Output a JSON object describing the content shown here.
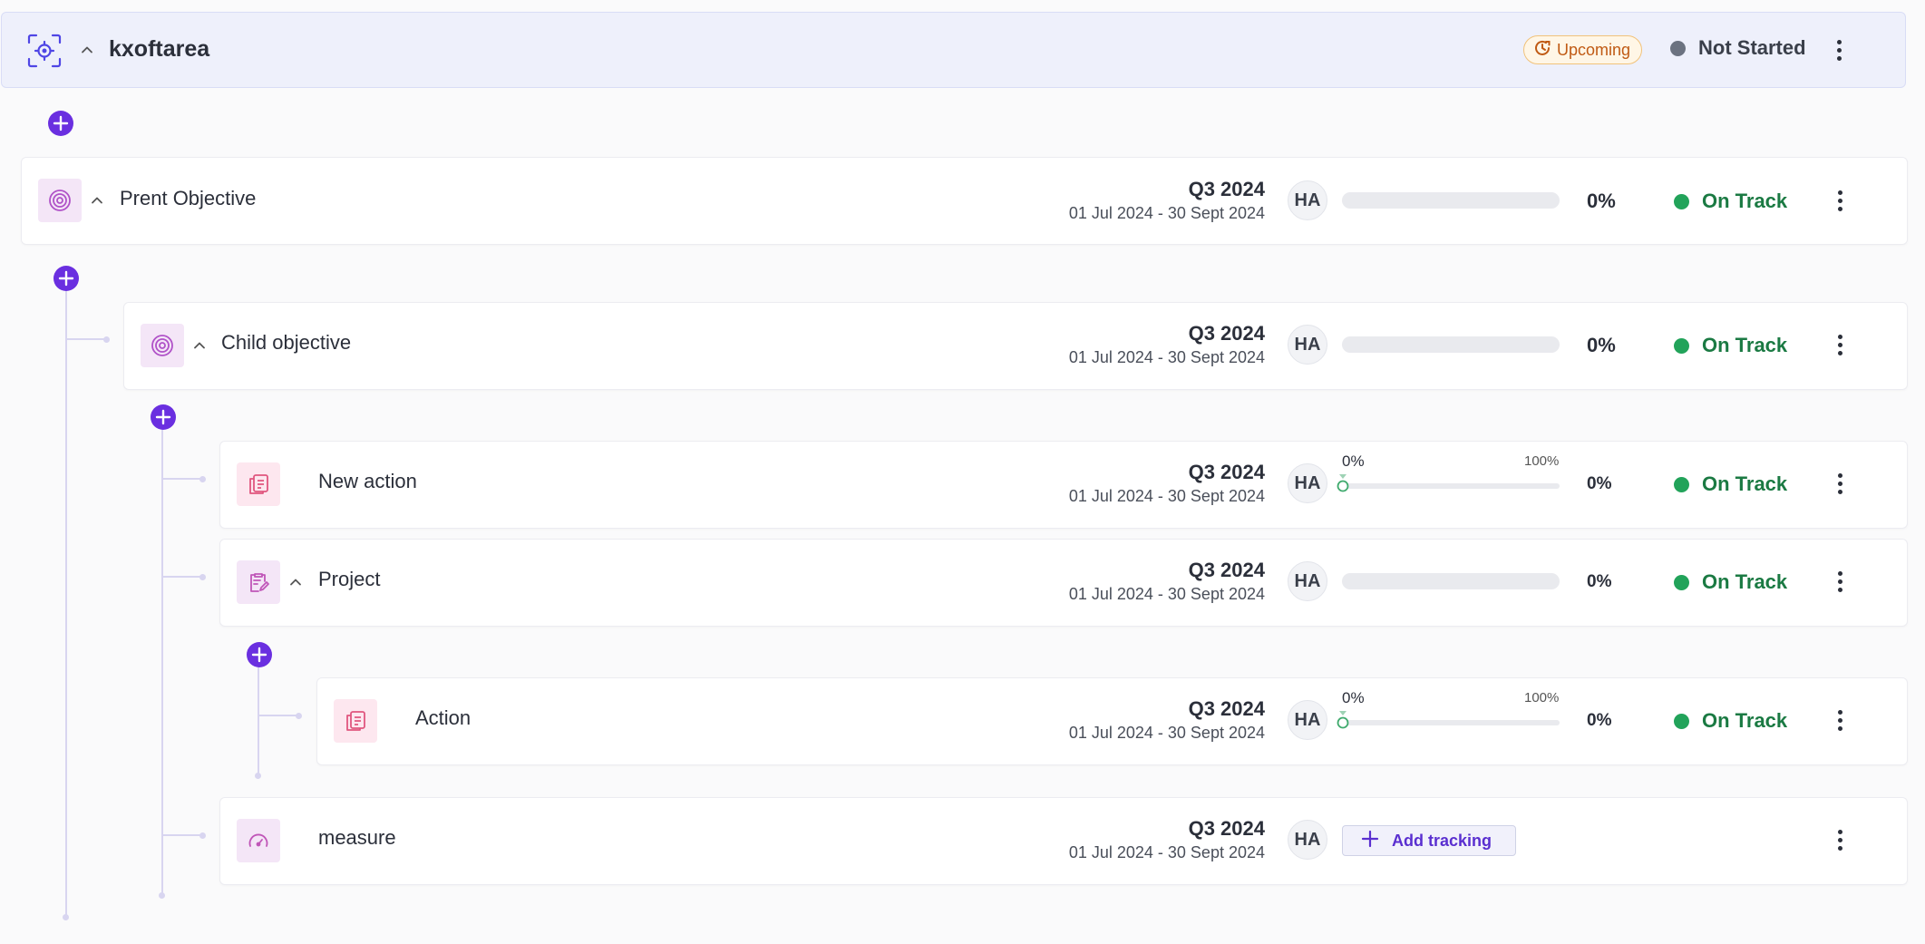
{
  "focus_area": {
    "title": "kxoftarea",
    "upcoming_badge": "Upcoming",
    "status": "Not Started",
    "status_color": "#6b7280"
  },
  "colors": {
    "accent": "#6a2fe0",
    "on_track": "#22a35a",
    "on_track_text": "#1b7a43",
    "upcoming": "#c05a14"
  },
  "rows": [
    {
      "type": "objective",
      "icon": "target-icon",
      "title": "Prent Objective",
      "period": "Q3 2024",
      "dates": "01 Jul 2024 - 30 Sept 2024",
      "owner": "HA",
      "progress": 0,
      "progress_label": "0%",
      "status": "On Track"
    },
    {
      "type": "objective",
      "icon": "target-icon",
      "title": "Child objective",
      "period": "Q3 2024",
      "dates": "01 Jul 2024 - 30 Sept 2024",
      "owner": "HA",
      "progress": 0,
      "progress_label": "0%",
      "status": "On Track"
    },
    {
      "type": "action",
      "icon": "action-icon",
      "title": "New action",
      "period": "Q3 2024",
      "dates": "01 Jul 2024 - 30 Sept 2024",
      "owner": "HA",
      "slider_min": "0%",
      "slider_max": "100%",
      "progress": 0,
      "progress_label": "0%",
      "status": "On Track"
    },
    {
      "type": "project",
      "icon": "project-icon",
      "title": "Project",
      "period": "Q3 2024",
      "dates": "01 Jul 2024 - 30 Sept 2024",
      "owner": "HA",
      "progress": 0,
      "progress_label": "0%",
      "status": "On Track"
    },
    {
      "type": "action",
      "icon": "action-icon",
      "title": "Action",
      "period": "Q3 2024",
      "dates": "01 Jul 2024 - 30 Sept 2024",
      "owner": "HA",
      "slider_min": "0%",
      "slider_max": "100%",
      "progress": 0,
      "progress_label": "0%",
      "status": "On Track"
    },
    {
      "type": "measure",
      "icon": "gauge-icon",
      "title": "measure",
      "period": "Q3 2024",
      "dates": "01 Jul 2024 - 30 Sept 2024",
      "owner": "HA",
      "add_tracking_label": "Add tracking"
    }
  ]
}
